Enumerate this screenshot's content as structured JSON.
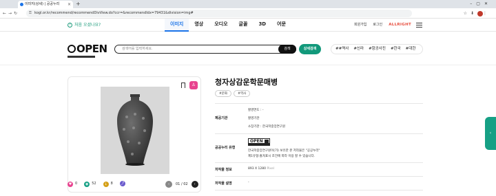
{
  "browser": {
    "tab_title": "이미지(상세) | 공공누리",
    "url": "kogl.or.kr/recommend/recommendDivView.do?ccr=&recommendIdx=79431&division=img#"
  },
  "nav": {
    "first_time": "처음 오셨나요?",
    "categories": [
      "이미지",
      "영상",
      "오디오",
      "글꼴",
      "3D",
      "어문"
    ],
    "login_links": [
      "회원가입",
      "로그인"
    ],
    "brand_text": "ALLRIGHT"
  },
  "logo": {
    "text": "OPEN"
  },
  "search": {
    "placeholder": "검색어를 입력하세요.",
    "button": "검색",
    "advanced_button": "상세검색",
    "hashtags": [
      "##역사",
      "#신라",
      "#항공사진",
      "#한국",
      "#대한"
    ]
  },
  "item": {
    "title": "청자상감운학문매병",
    "tags": [
      "#문화",
      "#역사"
    ],
    "stats": {
      "likes": "0",
      "views": "52",
      "downloads": "8"
    },
    "page": "01 / 02",
    "accent_color": "#e8438f"
  },
  "details": {
    "provider_label": "제공기관",
    "provider_rows": [
      "촬영연도 : -",
      "촬영기관",
      "소장기관 : 한국학중앙연구원"
    ],
    "license_label": "공공누리 유형",
    "license_lines": [
      "한국학중앙연구원이(가) 보유한 본 저작물은 \"공공누리\"",
      "제1유형:출처표시 조건에 따라 이용 할 수 있습니다."
    ],
    "size_label": "저작물 정보",
    "size_value": "893 X 1280",
    "size_unit": "Pixel",
    "desc_label": "저작물 설명",
    "desc_value": "-"
  }
}
